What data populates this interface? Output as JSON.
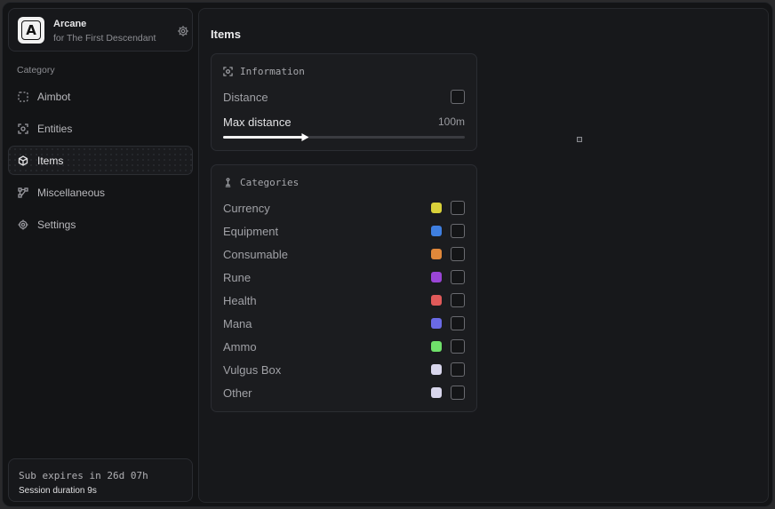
{
  "brand": {
    "logo_letter": "A",
    "name": "Arcane",
    "subtitle": "for The First Descendant"
  },
  "sidebar": {
    "category_label": "Category",
    "items": [
      {
        "label": "Aimbot",
        "icon": "crosshair-dashed-icon"
      },
      {
        "label": "Entities",
        "icon": "scan-face-icon"
      },
      {
        "label": "Items",
        "icon": "box-icon",
        "active": true
      },
      {
        "label": "Miscellaneous",
        "icon": "workflow-icon"
      },
      {
        "label": "Settings",
        "icon": "gear-icon"
      }
    ]
  },
  "subscription": {
    "expires": "Sub expires in 26d 07h",
    "session": "Session duration 9s"
  },
  "main": {
    "title": "Items",
    "information": {
      "heading": "Information",
      "distance_label": "Distance",
      "distance_checked": false,
      "max_distance_label": "Max distance",
      "max_distance_value": "100m",
      "slider_fraction": 0.34
    },
    "categories": {
      "heading": "Categories",
      "items": [
        {
          "label": "Currency",
          "color": "#d9d13a",
          "checked": false
        },
        {
          "label": "Equipment",
          "color": "#3f7fe0",
          "checked": false
        },
        {
          "label": "Consumable",
          "color": "#e0883a",
          "checked": false
        },
        {
          "label": "Rune",
          "color": "#9a45d6",
          "checked": false
        },
        {
          "label": "Health",
          "color": "#e05a5a",
          "checked": false
        },
        {
          "label": "Mana",
          "color": "#6a6ae6",
          "checked": false
        },
        {
          "label": "Ammo",
          "color": "#6fe06a",
          "checked": false
        },
        {
          "label": "Vulgus Box",
          "color": "#d8d6ec",
          "checked": false
        },
        {
          "label": "Other",
          "color": "#d8d6ec",
          "checked": false
        }
      ]
    }
  }
}
